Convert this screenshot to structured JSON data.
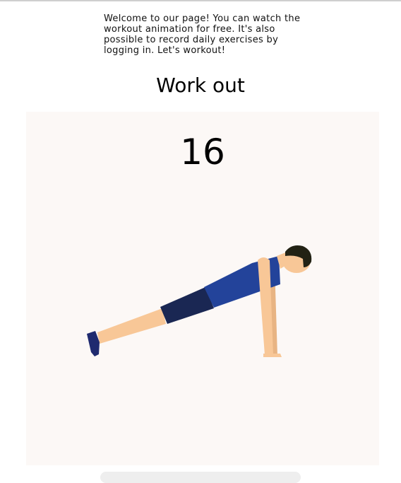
{
  "intro": {
    "text": "Welcome to our page! You can watch the workout animation for free. It's also possible to record daily exercises by logging in. Let's workout!"
  },
  "page": {
    "title": "Work out"
  },
  "workout": {
    "rep_count": "16",
    "figure": "push-up-figure",
    "colors": {
      "stage_bg": "#fcf8f6",
      "skin": "#f8c797",
      "shirt": "#23439a",
      "shorts": "#1a2753",
      "hair": "#222214",
      "shoe": "#1f2a6f"
    }
  }
}
